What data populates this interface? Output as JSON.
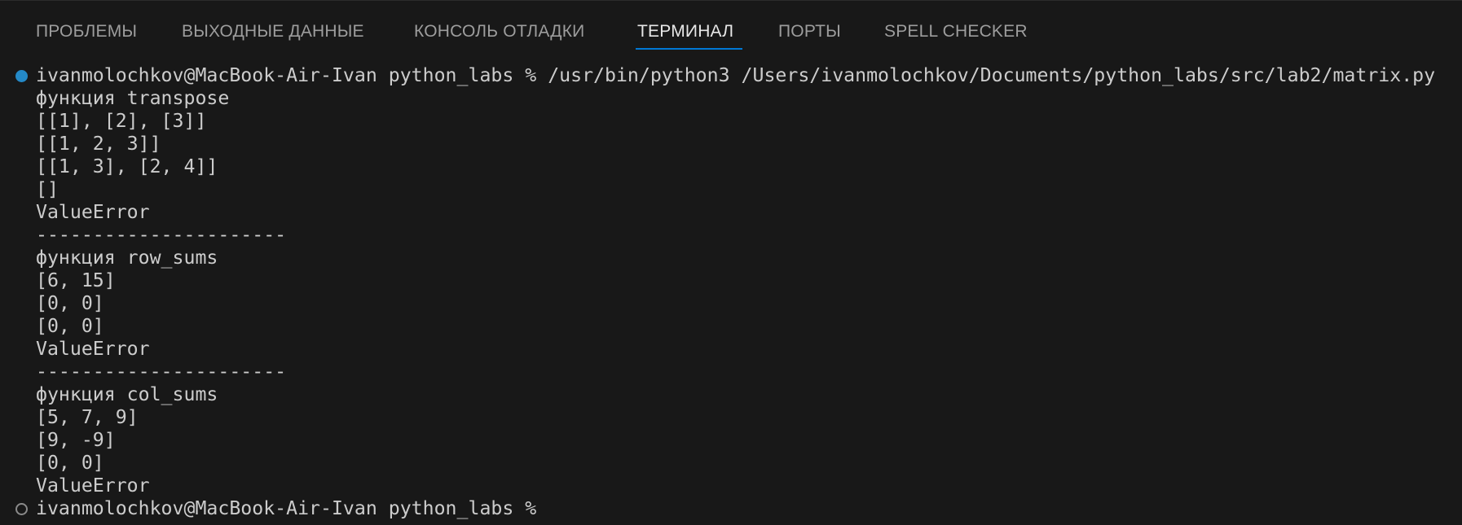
{
  "tabs": [
    {
      "label": "ПРОБЛЕМЫ",
      "active": false
    },
    {
      "label": "ВЫХОДНЫЕ ДАННЫЕ",
      "active": false
    },
    {
      "label": "КОНСОЛЬ ОТЛАДКИ",
      "active": false
    },
    {
      "label": "ТЕРМИНАЛ",
      "active": true
    },
    {
      "label": "ПОРТЫ",
      "active": false
    },
    {
      "label": "SPELL CHECKER",
      "active": false
    }
  ],
  "colors": {
    "background": "#181818",
    "text": "#cccccc",
    "tab_inactive": "#9d9d9d",
    "tab_active": "#e7e7e7",
    "accent": "#0078d4",
    "decoration_success": "#2489c7",
    "decoration_idle": "#8a8a8a"
  },
  "terminal": {
    "lines": [
      "ivanmolochkov@MacBook-Air-Ivan python_labs % /usr/bin/python3 /Users/ivanmolochkov/Documents/python_labs/src/lab2/matrix.py",
      "функция transpose",
      "[[1], [2], [3]]",
      "[[1, 2, 3]]",
      "[[1, 3], [2, 4]]",
      "[]",
      "ValueError",
      "----------------------",
      "функция row_sums",
      "[6, 15]",
      "[0, 0]",
      "[0, 0]",
      "ValueError",
      "----------------------",
      "функция col_sums",
      "[5, 7, 9]",
      "[9, -9]",
      "[0, 0]",
      "ValueError",
      "ivanmolochkov@MacBook-Air-Ivan python_labs % "
    ],
    "decorations": [
      {
        "line": 0,
        "kind": "success-icon"
      },
      {
        "line": 19,
        "kind": "idle-icon"
      }
    ]
  }
}
